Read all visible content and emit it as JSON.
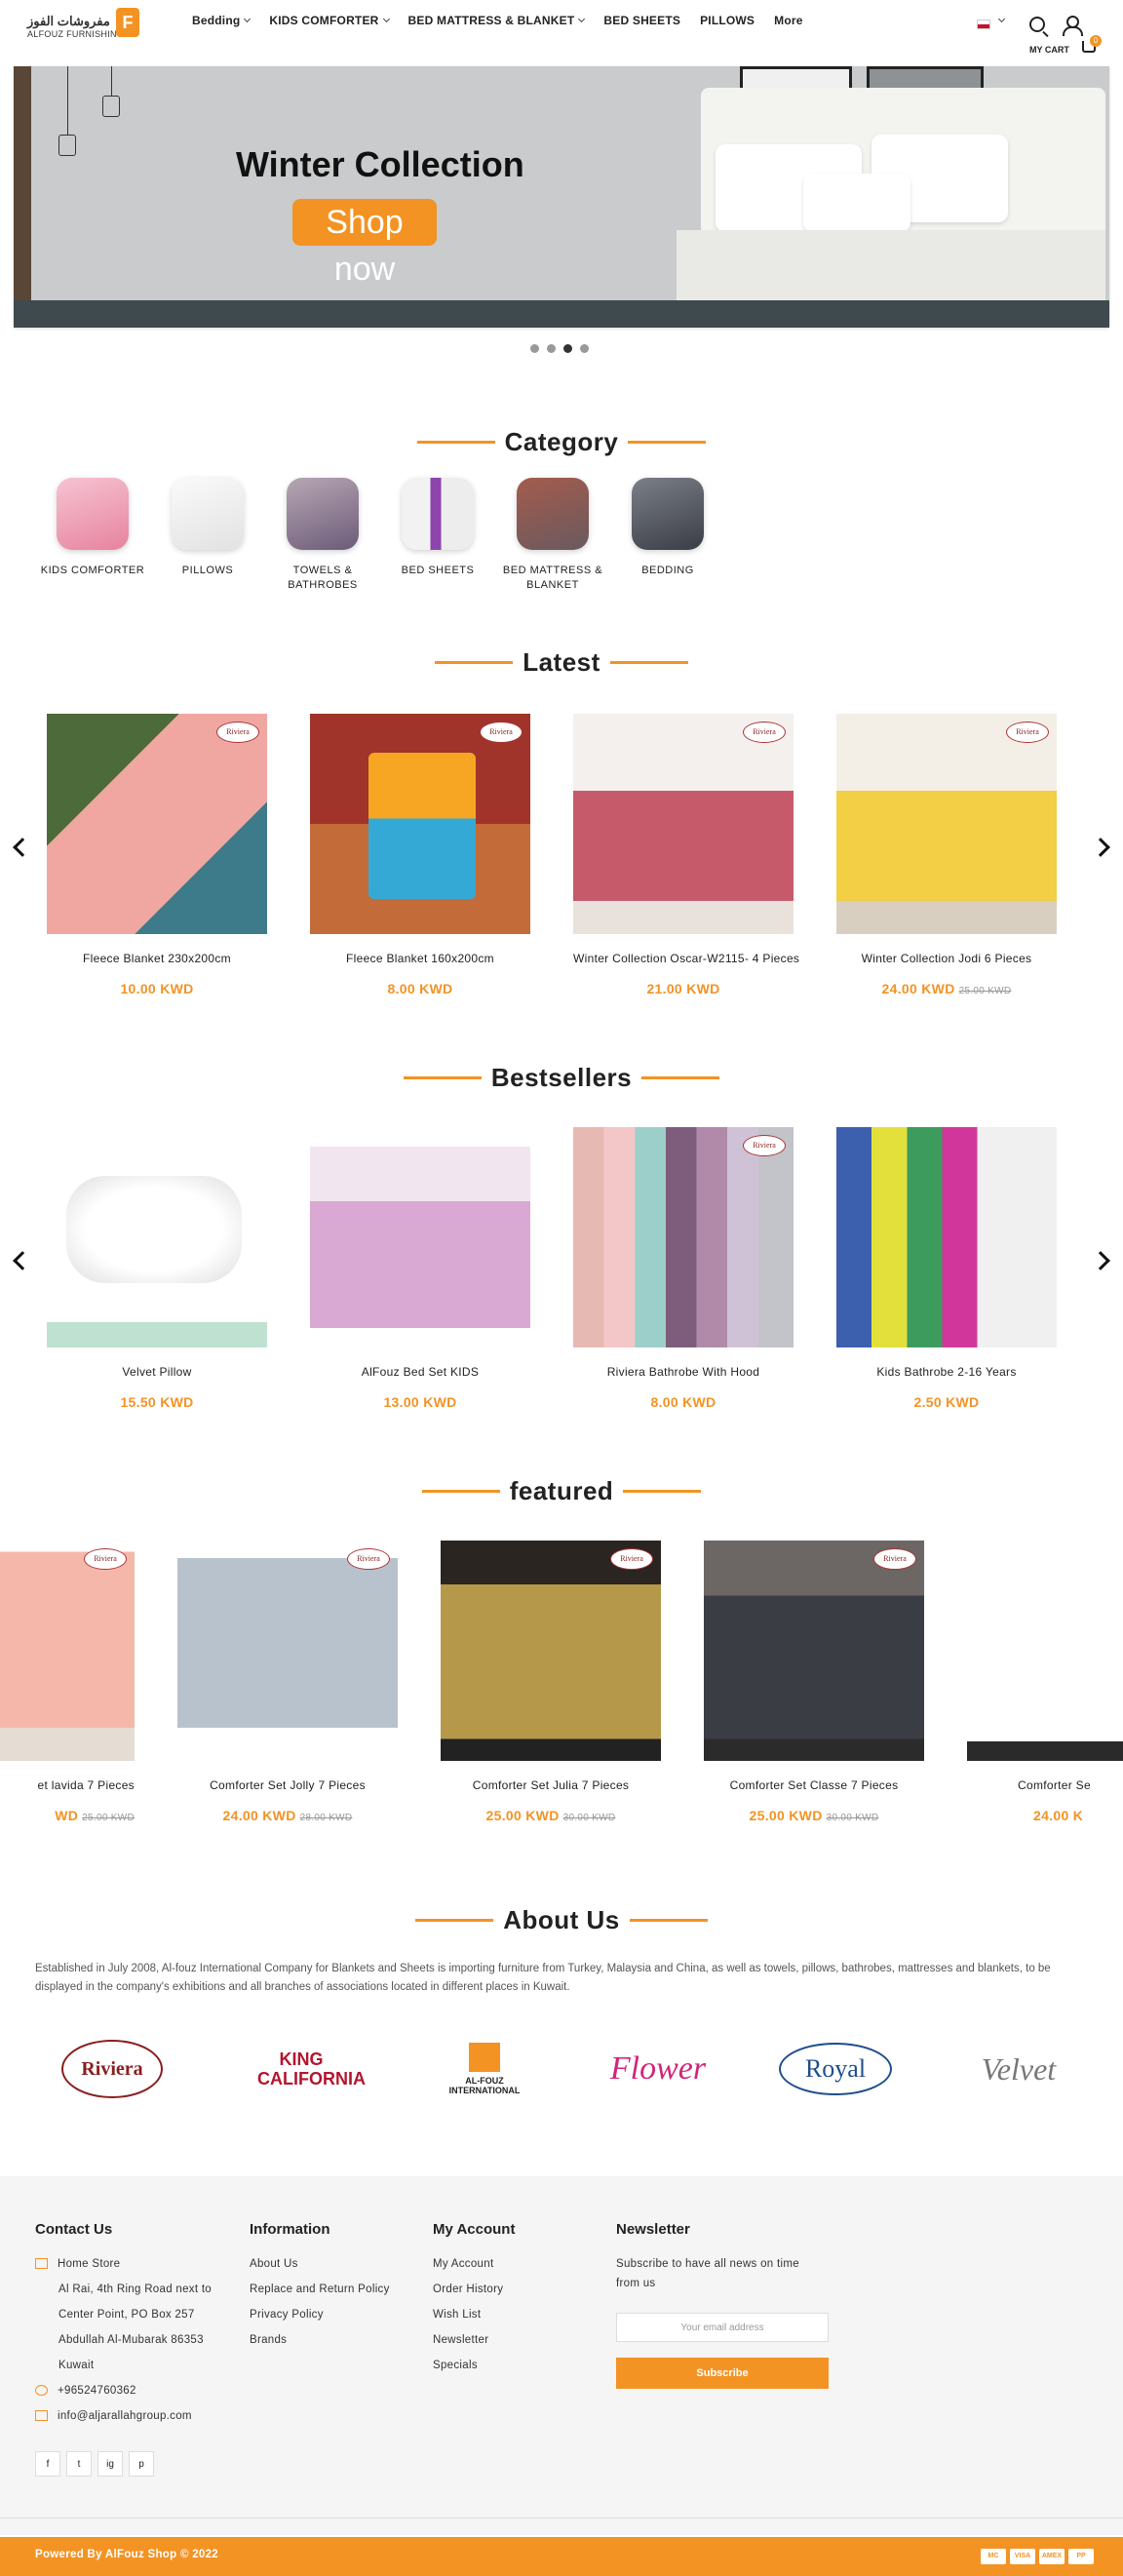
{
  "header": {
    "logo_ar": "مفروشات الفوز",
    "logo_en": "ALFOUZ FURNISHINGS",
    "logo_badge": "F",
    "nav": [
      "Bedding",
      "KIDS COMFORTER",
      "BED MATTRESS & BLANKET",
      "BED SHEETS",
      "PILLOWS",
      "More"
    ],
    "cart_label": "MY CART",
    "cart_count": "0"
  },
  "hero": {
    "title": "Winter Collection",
    "button": "Shop now",
    "slides": 4,
    "active_slide": 3
  },
  "sections": {
    "category": "Category",
    "latest": "Latest",
    "bestsellers": "Bestsellers",
    "featured": "featured",
    "about": "About Us"
  },
  "categories": [
    "KIDS COMFORTER",
    "PILLOWS",
    "TOWELS & BATHROBES",
    "BED SHEETS",
    "BED MATTRESS & BLANKET",
    "BEDDING"
  ],
  "latest": [
    {
      "name": "Fleece Blanket 230x200cm",
      "price": "10.00 KWD",
      "old": ""
    },
    {
      "name": "Fleece Blanket 160x200cm",
      "price": "8.00 KWD",
      "old": ""
    },
    {
      "name": "Winter Collection Oscar-W2115- 4 Pieces",
      "price": "21.00 KWD",
      "old": ""
    },
    {
      "name": "Winter Collection Jodi 6 Pieces",
      "price": "24.00 KWD",
      "old": "25.00 KWD"
    }
  ],
  "bestsellers": [
    {
      "name": "Velvet Pillow",
      "price": "15.50 KWD",
      "old": ""
    },
    {
      "name": "AlFouz Bed Set KIDS",
      "price": "13.00 KWD",
      "old": ""
    },
    {
      "name": "Riviera Bathrobe With Hood",
      "price": "8.00 KWD",
      "old": ""
    },
    {
      "name": "Kids Bathrobe 2-16 Years",
      "price": "2.50 KWD",
      "old": ""
    }
  ],
  "featured": [
    {
      "name": "et lavida 7 Pieces",
      "price": "WD",
      "old": "25.00 KWD"
    },
    {
      "name": "Comforter Set Jolly 7 Pieces",
      "price": "24.00 KWD",
      "old": "28.00 KWD"
    },
    {
      "name": "Comforter Set Julia 7 Pieces",
      "price": "25.00 KWD",
      "old": "30.00 KWD"
    },
    {
      "name": "Comforter Set Classe 7 Pieces",
      "price": "25.00 KWD",
      "old": "30.00 KWD"
    },
    {
      "name": "Comforter Se",
      "price": "24.00 K",
      "old": ""
    }
  ],
  "about": {
    "text": "Established in July 2008, Al-fouz International Company for Blankets and Sheets is importing furniture from Turkey, Malaysia and China, as well as towels, pillows, bathrobes, mattresses and blankets, to be displayed in the company's exhibitions and all branches of associations located in different places in Kuwait.",
    "brands": [
      "Riviera",
      "KING CALIFORNIA",
      "AL-FOUZ INTERNATIONAL",
      "Flower",
      "Royal",
      "Velvet"
    ]
  },
  "footer": {
    "contact": {
      "title": "Contact Us",
      "store": "Home Store",
      "address": [
        "Al Rai, 4th Ring Road next to",
        "Center Point, PO Box 257",
        "Abdullah Al-Mubarak 86353",
        "Kuwait"
      ],
      "phone": "+96524760362",
      "email": "info@aljarallahgroup.com"
    },
    "information": {
      "title": "Information",
      "links": [
        "About Us",
        "Replace and Return Policy",
        "Privacy Policy",
        "Brands"
      ]
    },
    "account": {
      "title": "My Account",
      "links": [
        "My Account",
        "Order History",
        "Wish List",
        "Newsletter",
        "Specials"
      ]
    },
    "newsletter": {
      "title": "Newsletter",
      "text": [
        "Subscribe to have all news on time",
        "from us"
      ],
      "placeholder": "Your email address",
      "button": "Subscribe"
    },
    "socials": [
      "f",
      "t",
      "ig",
      "p"
    ],
    "copyright": "Powered By AlFouz Shop © 2022",
    "payments": [
      "MC",
      "VISA",
      "AMEX",
      "PP"
    ]
  },
  "colors": {
    "accent": "#f39324",
    "footer_bg": "#f5f5f5"
  }
}
